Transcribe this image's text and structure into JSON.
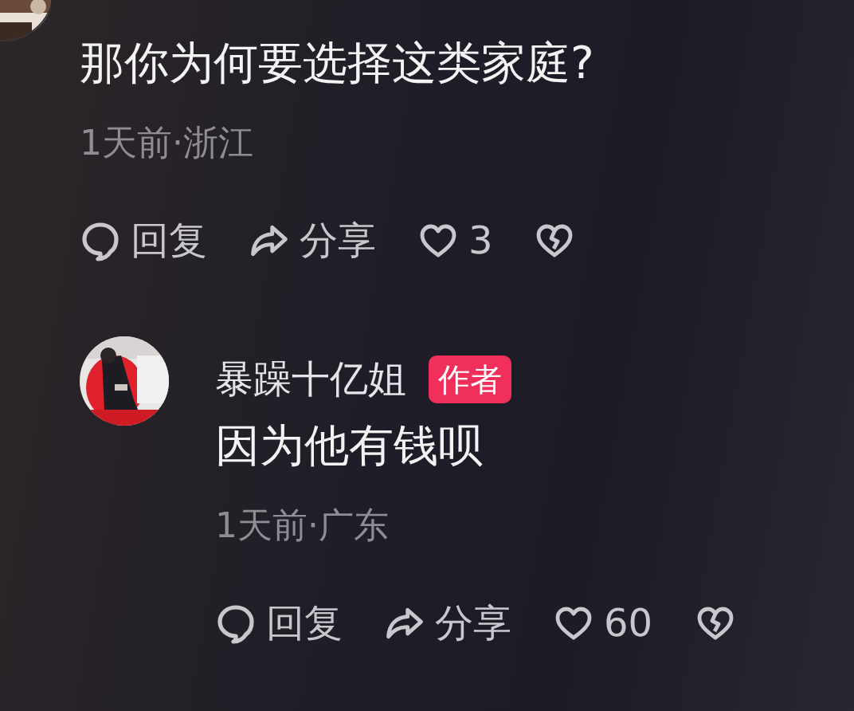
{
  "comments": [
    {
      "kind": "comment",
      "text": "那你为何要选择这类家庭?",
      "meta": "1天前·浙江",
      "actions": {
        "reply": "回复",
        "share": "分享",
        "likes": "3"
      }
    },
    {
      "kind": "reply",
      "author": "暴躁十亿姐",
      "badge": "作者",
      "text": "因为他有钱呗",
      "meta": "1天前·广东",
      "actions": {
        "reply": "回复",
        "share": "分享",
        "likes": "60"
      }
    }
  ]
}
